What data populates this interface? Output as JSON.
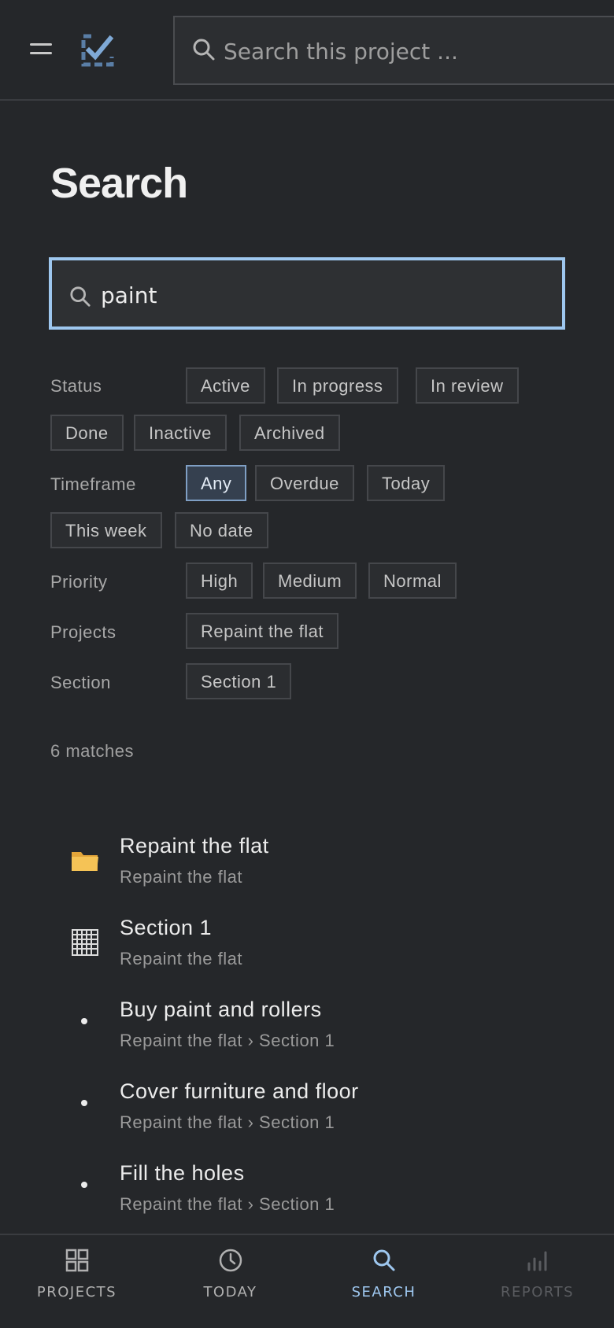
{
  "topbar": {
    "search_placeholder": "Search this project ...",
    "menu_icon": "hamburger-menu-icon",
    "logo_icon": "checkbox-logo-icon"
  },
  "page": {
    "title": "Search"
  },
  "search": {
    "value": "paint",
    "focus_color": "#9ec7ef"
  },
  "filters": {
    "status": {
      "label": "Status",
      "options": [
        "Active",
        "In progress",
        "In review",
        "Done",
        "Inactive",
        "Archived"
      ]
    },
    "timeframe": {
      "label": "Timeframe",
      "options": [
        "Any",
        "Overdue",
        "Today",
        "This week",
        "No date"
      ],
      "selected": "Any"
    },
    "priority": {
      "label": "Priority",
      "options": [
        "High",
        "Medium",
        "Normal"
      ]
    },
    "projects": {
      "label": "Projects",
      "options": [
        "Repaint the flat"
      ]
    },
    "section": {
      "label": "Section",
      "options": [
        "Section 1"
      ]
    }
  },
  "results": {
    "count_text": "6 matches",
    "items": [
      {
        "title": "Repaint the flat",
        "subtitle": "Repaint the flat",
        "icon": "folder-icon"
      },
      {
        "title": "Section 1",
        "subtitle": "Repaint the flat",
        "icon": "grid-icon"
      },
      {
        "title": "Buy paint and rollers",
        "subtitle": "Repaint the flat › Section 1",
        "icon": "bullet-icon"
      },
      {
        "title": "Cover furniture and floor",
        "subtitle": "Repaint the flat › Section 1",
        "icon": "bullet-icon"
      },
      {
        "title": "Fill the holes",
        "subtitle": "Repaint the flat › Section 1",
        "icon": "bullet-icon"
      }
    ]
  },
  "bottom_nav": {
    "items": [
      {
        "label": "PROJECTS",
        "icon": "grid-icon"
      },
      {
        "label": "TODAY",
        "icon": "clock-icon"
      },
      {
        "label": "SEARCH",
        "icon": "search-icon",
        "active": true
      },
      {
        "label": "REPORTS",
        "icon": "bar-chart-icon",
        "disabled": true
      }
    ],
    "active_color": "#9ec7ef",
    "inactive_color": "#b0b0b0",
    "disabled_color": "#5a5c60"
  }
}
